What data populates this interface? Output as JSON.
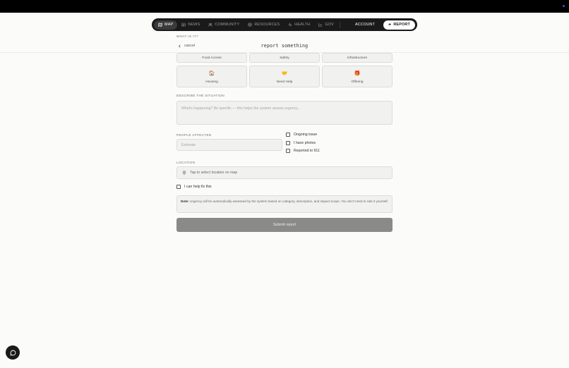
{
  "nav": {
    "items": [
      {
        "label": "MAP",
        "icon": "map-icon",
        "active": true
      },
      {
        "label": "NEWS",
        "icon": "newspaper-icon",
        "active": false
      },
      {
        "label": "COMMUNITY",
        "icon": "users-icon",
        "active": false
      },
      {
        "label": "RESOURCES",
        "icon": "box-icon",
        "active": false
      },
      {
        "label": "HEALTH",
        "icon": "pulse-icon",
        "active": false
      },
      {
        "label": "GOV",
        "icon": "chart-icon",
        "active": false
      }
    ],
    "account_label": "ACCOUNT",
    "report_label": "REPORT",
    "report_icon": "plus-icon"
  },
  "form": {
    "what_label": "WHAT IS IT?",
    "cancel_label": "cancel",
    "title": "report something",
    "categories_row1": [
      "Food Access",
      "Safety",
      "Infrastructure"
    ],
    "categories_row2": [
      {
        "label": "Housing",
        "emoji": "🏠"
      },
      {
        "label": "Need Help",
        "emoji": "🤝"
      },
      {
        "label": "Offering",
        "emoji": "🎁"
      }
    ],
    "describe_label": "DESCRIBE THE SITUATION",
    "describe_placeholder": "What's happening? Be specific — this helps the system assess urgency...",
    "people_label": "PEOPLE AFFECTED",
    "people_placeholder": "Estimate",
    "checks": [
      "Ongoing issue",
      "I have photos",
      "Reported to 911"
    ],
    "location_label": "LOCATION",
    "location_placeholder": "Tap to select location on map",
    "location_icon": "map-pin-icon",
    "help_fix_label": "I can help fix this",
    "note_title": "Note:",
    "note_text": "Urgency will be automatically assessed by the system based on category, description, and impact scope. You don't need to rate it yourself.",
    "submit_label": "Submit report"
  },
  "chat": {
    "icon": "chat-bubble-icon"
  },
  "colors": {
    "nav_bg": "#1a1a1a",
    "submit_bg": "#8a8a88",
    "page_bg": "#fbfbfa"
  }
}
